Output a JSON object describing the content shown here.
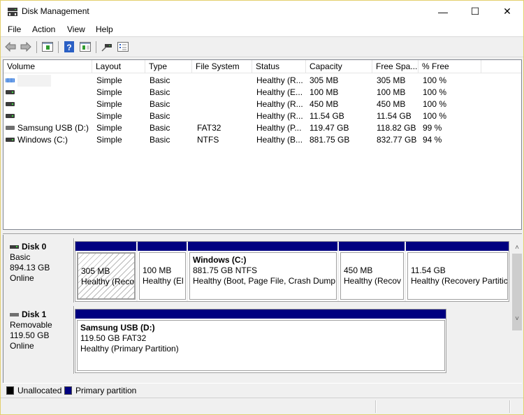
{
  "window": {
    "title": "Disk Management",
    "minimize": "—",
    "maximize": "☐",
    "close": "✕"
  },
  "menu": [
    "File",
    "Action",
    "View",
    "Help"
  ],
  "toolbar": {
    "icons": [
      "back-arrow-icon",
      "forward-arrow-icon",
      "console-tree-icon",
      "help-icon",
      "action-pane-icon",
      "connect-icon",
      "properties-icon"
    ]
  },
  "volume_list": {
    "columns": [
      "Volume",
      "Layout",
      "Type",
      "File System",
      "Status",
      "Capacity",
      "Free Spa...",
      "% Free"
    ],
    "rows": [
      {
        "icon": "recovery",
        "volume": "",
        "layout": "Simple",
        "type": "Basic",
        "fs": "",
        "status": "Healthy (R...",
        "capacity": "305 MB",
        "free": "305 MB",
        "pct": "100 %"
      },
      {
        "icon": "drive",
        "volume": "",
        "layout": "Simple",
        "type": "Basic",
        "fs": "",
        "status": "Healthy (E...",
        "capacity": "100 MB",
        "free": "100 MB",
        "pct": "100 %"
      },
      {
        "icon": "drive",
        "volume": "",
        "layout": "Simple",
        "type": "Basic",
        "fs": "",
        "status": "Healthy (R...",
        "capacity": "450 MB",
        "free": "450 MB",
        "pct": "100 %"
      },
      {
        "icon": "drive",
        "volume": "",
        "layout": "Simple",
        "type": "Basic",
        "fs": "",
        "status": "Healthy (R...",
        "capacity": "11.54 GB",
        "free": "11.54 GB",
        "pct": "100 %"
      },
      {
        "icon": "usb",
        "volume": "Samsung USB (D:)",
        "layout": "Simple",
        "type": "Basic",
        "fs": "FAT32",
        "status": "Healthy (P...",
        "capacity": "119.47 GB",
        "free": "118.82 GB",
        "pct": "99 %"
      },
      {
        "icon": "drive",
        "volume": "Windows (C:)",
        "layout": "Simple",
        "type": "Basic",
        "fs": "NTFS",
        "status": "Healthy (B...",
        "capacity": "881.75 GB",
        "free": "832.77 GB",
        "pct": "94 %"
      }
    ]
  },
  "disks": [
    {
      "name": "Disk 0",
      "type": "Basic",
      "size": "894.13 GB",
      "state": "Online",
      "partitions": [
        {
          "title": "",
          "line1": "305 MB",
          "line2": "Healthy (Reco",
          "selected": true
        },
        {
          "title": "",
          "line1": "100 MB",
          "line2": "Healthy (El",
          "selected": false
        },
        {
          "title": "Windows  (C:)",
          "line1": "881.75 GB NTFS",
          "line2": "Healthy (Boot, Page File, Crash Dump,",
          "selected": false
        },
        {
          "title": "",
          "line1": "450 MB",
          "line2": "Healthy (Recov",
          "selected": false
        },
        {
          "title": "",
          "line1": "11.54 GB",
          "line2": "Healthy (Recovery Partitic",
          "selected": false
        }
      ]
    },
    {
      "name": "Disk 1",
      "type": "Removable",
      "size": "119.50 GB",
      "state": "Online",
      "partitions": [
        {
          "title": "Samsung USB  (D:)",
          "line1": "119.50 GB FAT32",
          "line2": "Healthy (Primary Partition)",
          "selected": false
        }
      ]
    }
  ],
  "legend": [
    {
      "label": "Unallocated",
      "color": "#000000"
    },
    {
      "label": "Primary partition",
      "color": "#000080"
    }
  ],
  "scrollbar": {
    "up": "˄",
    "down": "˅"
  }
}
